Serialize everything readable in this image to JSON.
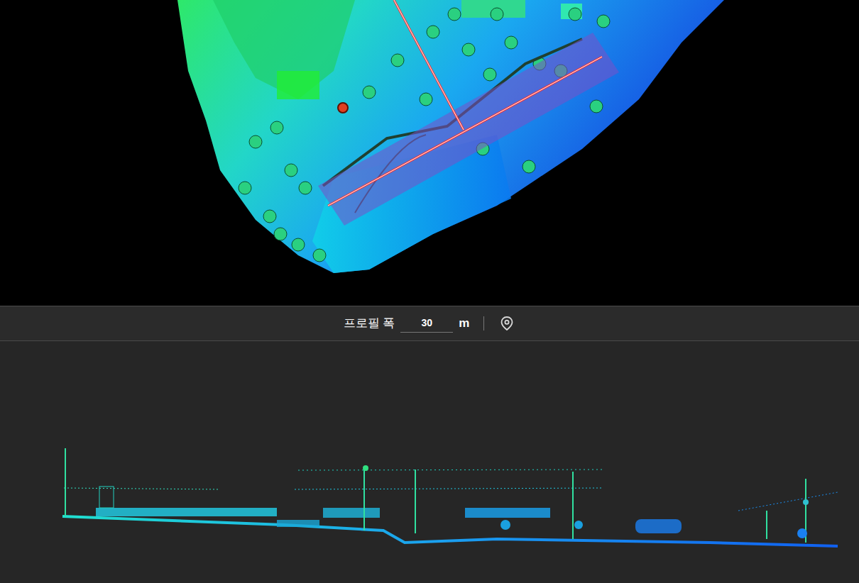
{
  "profile_toolbar": {
    "label": "프로필 폭",
    "width_value": "30",
    "unit": "m"
  }
}
